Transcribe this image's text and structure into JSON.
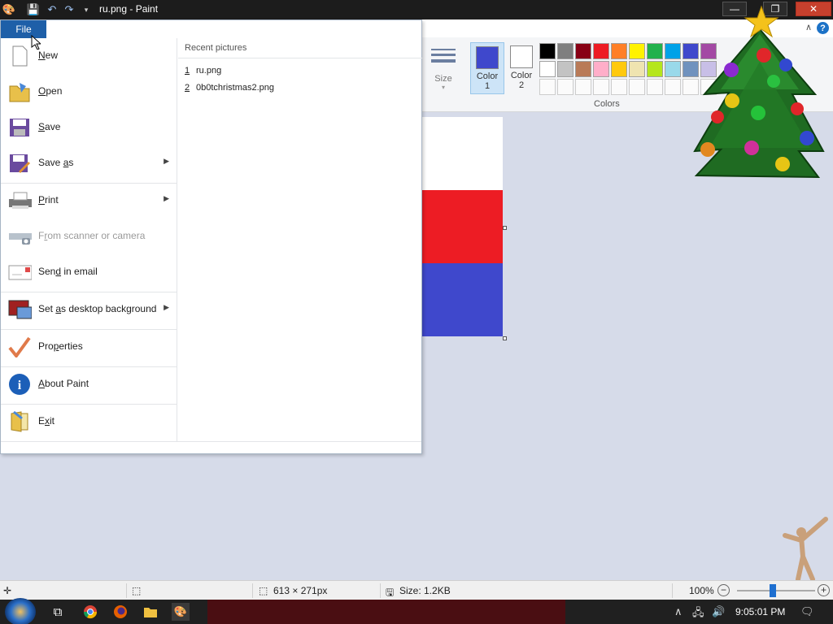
{
  "window": {
    "title": "ru.png - Paint",
    "minimize_icon": "minimize-icon",
    "maximize_icon": "maximize-icon",
    "close_icon": "close-icon"
  },
  "file_menu": {
    "tab_label": "File",
    "items": [
      {
        "label": "New",
        "icon": "new-file-icon"
      },
      {
        "label": "Open",
        "icon": "open-folder-icon"
      },
      {
        "label": "Save",
        "icon": "save-icon"
      },
      {
        "label": "Save as",
        "icon": "save-as-icon",
        "submenu": true
      },
      {
        "label": "Print",
        "icon": "printer-icon",
        "submenu": true
      },
      {
        "label": "From scanner or camera",
        "icon": "scanner-icon",
        "disabled": true
      },
      {
        "label": "Send in email",
        "icon": "email-icon"
      },
      {
        "label": "Set as desktop background",
        "icon": "desktop-icon",
        "submenu": true
      },
      {
        "label": "Properties",
        "icon": "checkmark-icon"
      },
      {
        "label": "About Paint",
        "icon": "info-icon"
      },
      {
        "label": "Exit",
        "icon": "exit-icon"
      }
    ],
    "recent_header": "Recent pictures",
    "recent": [
      {
        "num": "1",
        "name": "ru.png"
      },
      {
        "num": "2",
        "name": "0b0tchristmas2.png"
      }
    ]
  },
  "ribbon": {
    "size_label": "Size",
    "color1_label": "Color 1",
    "color2_label": "Color 2",
    "colors_label": "Colors",
    "color1": "#3f48cc",
    "color2": "#ffffff",
    "palette_row1": [
      "#000000",
      "#7f7f7f",
      "#880015",
      "#ed1c24",
      "#ff7f27",
      "#fff200",
      "#22b14c",
      "#00a2e8",
      "#3f48cc",
      "#a349a4"
    ],
    "palette_row2": [
      "#ffffff",
      "#c3c3c3",
      "#b97a57",
      "#ffaec9",
      "#ffc90e",
      "#efe4b0",
      "#b5e61d",
      "#99d9ea",
      "#7092be",
      "#c8bfe7"
    ]
  },
  "canvas": {
    "stripes": [
      "#ffffff",
      "#ed1c24",
      "#3f48cc"
    ]
  },
  "status": {
    "dimensions": "613 × 271px",
    "size": "Size: 1.2KB",
    "zoom": "100%",
    "zoom_level": 100
  },
  "taskbar": {
    "clock": "9:05:01 PM"
  }
}
